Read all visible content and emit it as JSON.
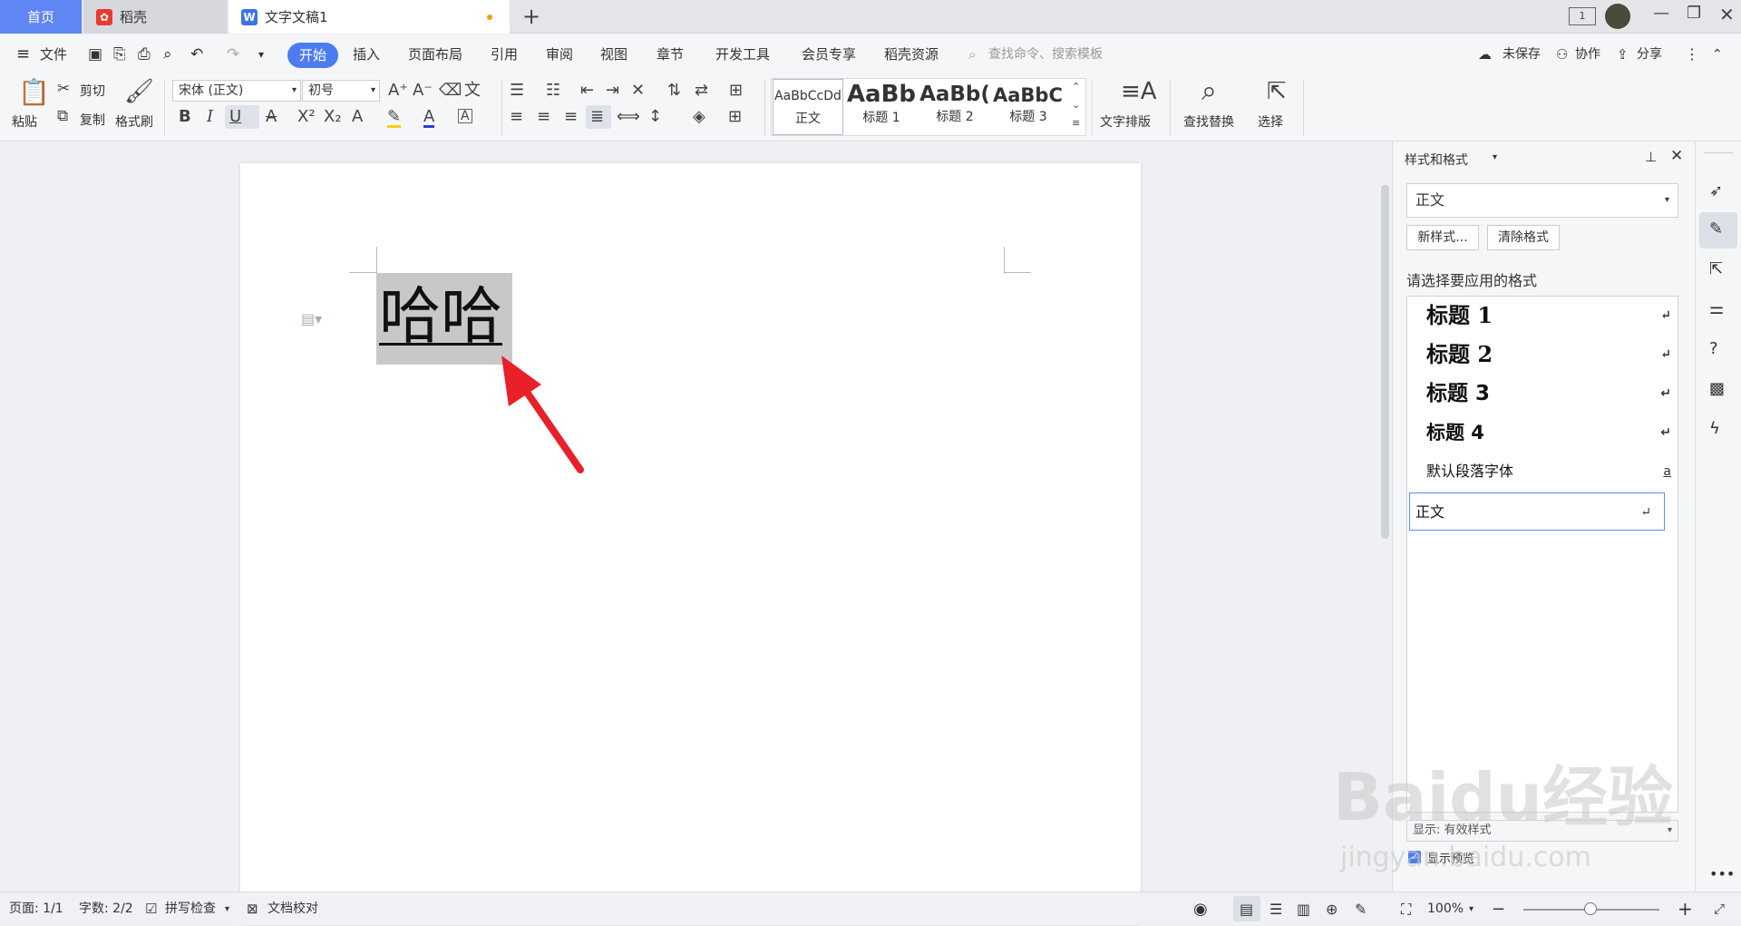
{
  "tabs": {
    "home": "首页",
    "daoke": "稻壳",
    "doc": "文字文稿1"
  },
  "menu": {
    "file": "文件",
    "tabs": [
      "开始",
      "插入",
      "页面布局",
      "引用",
      "审阅",
      "视图",
      "章节",
      "开发工具",
      "会员专享",
      "稻壳资源"
    ],
    "search_placeholder": "查找命令、搜索模板",
    "unsaved": "未保存",
    "collab": "协作",
    "share": "分享"
  },
  "ribbon": {
    "paste": "粘贴",
    "cut": "剪切",
    "copy": "复制",
    "format_painter": "格式刷",
    "font_name": "宋体 (正文)",
    "font_size": "初号",
    "styles": [
      {
        "preview": "AaBbCcDd",
        "label": "正文"
      },
      {
        "preview": "AaBb",
        "label": "标题 1"
      },
      {
        "preview": "AaBb(",
        "label": "标题 2"
      },
      {
        "preview": "AaBbC(",
        "label": "标题 3"
      }
    ],
    "text_layout": "文字排版",
    "find_replace": "查找替换",
    "select": "选择"
  },
  "document": {
    "text": "哈哈"
  },
  "panel": {
    "title": "样式和格式",
    "current_style": "正文",
    "new_style": "新样式...",
    "clear_format": "清除格式",
    "prompt": "请选择要应用的格式",
    "items": [
      {
        "label": "标题  1",
        "mark": "↵"
      },
      {
        "label": "标题  2",
        "mark": "↵"
      },
      {
        "label": "标题  3",
        "mark": "↵"
      },
      {
        "label": "标题  4",
        "mark": "↵"
      },
      {
        "label": "默认段落字体",
        "mark": "a"
      },
      {
        "label": "正文",
        "mark": "↵"
      }
    ],
    "show": "显示: 有效样式",
    "show_preview": "显示预览"
  },
  "status": {
    "page": "页面: 1/1",
    "words": "字数: 2/2",
    "spell": "拼写检查",
    "proof": "文档校对",
    "zoom": "100%",
    "zoom_level_percent": 100
  },
  "watermark": {
    "text1": "Baidu经验",
    "text2": "jingyan.baidu.com"
  },
  "colors": {
    "accent": "#4d7cf2",
    "arrow": "#e8202a",
    "selection": "#c8c8c8"
  }
}
